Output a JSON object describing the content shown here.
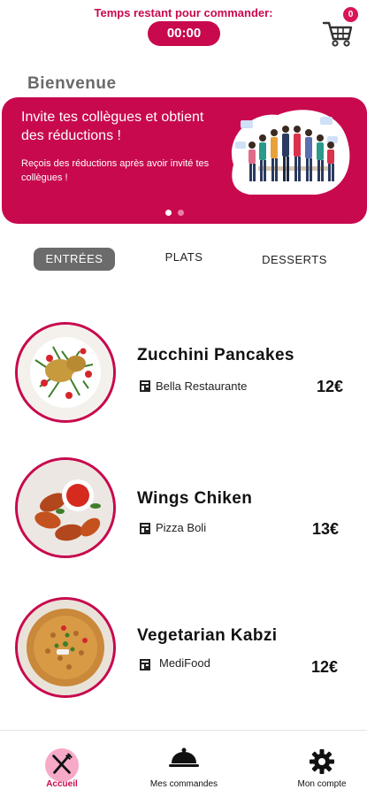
{
  "header": {
    "timer_label": "Temps restant pour commander:",
    "timer_value": "00:00",
    "cart_count": "0"
  },
  "welcome": "Bienvenue",
  "banner": {
    "title": "Invite tes collègues et obtient des réductions !",
    "subtitle": "Reçois des réductions après avoir invité tes collègues !",
    "active_dot": 0,
    "dot_count": 2
  },
  "tabs": [
    {
      "label": "ENTRÉES",
      "active": true
    },
    {
      "label": "PLATS",
      "active": false
    },
    {
      "label": "DESSERTS",
      "active": false
    }
  ],
  "items": [
    {
      "name": "Zucchini Pancakes",
      "restaurant": "Bella Restaurante",
      "price": "12€"
    },
    {
      "name": "Wings Chiken",
      "restaurant": "Pizza Boli",
      "price": "13€"
    },
    {
      "name": "Vegetarian Kabzi",
      "restaurant": "MediFood",
      "price": "12€"
    }
  ],
  "nav": [
    {
      "label": "Accueil",
      "icon": "fork-knife-icon",
      "active": true
    },
    {
      "label": "Mes commandes",
      "icon": "cloche-icon",
      "active": false
    },
    {
      "label": "Mon compte",
      "icon": "gear-icon",
      "active": false
    }
  ],
  "colors": {
    "accent": "#c8094e",
    "tab_active": "#6b6b6b",
    "nav_active_bg": "#f7a9c8"
  }
}
